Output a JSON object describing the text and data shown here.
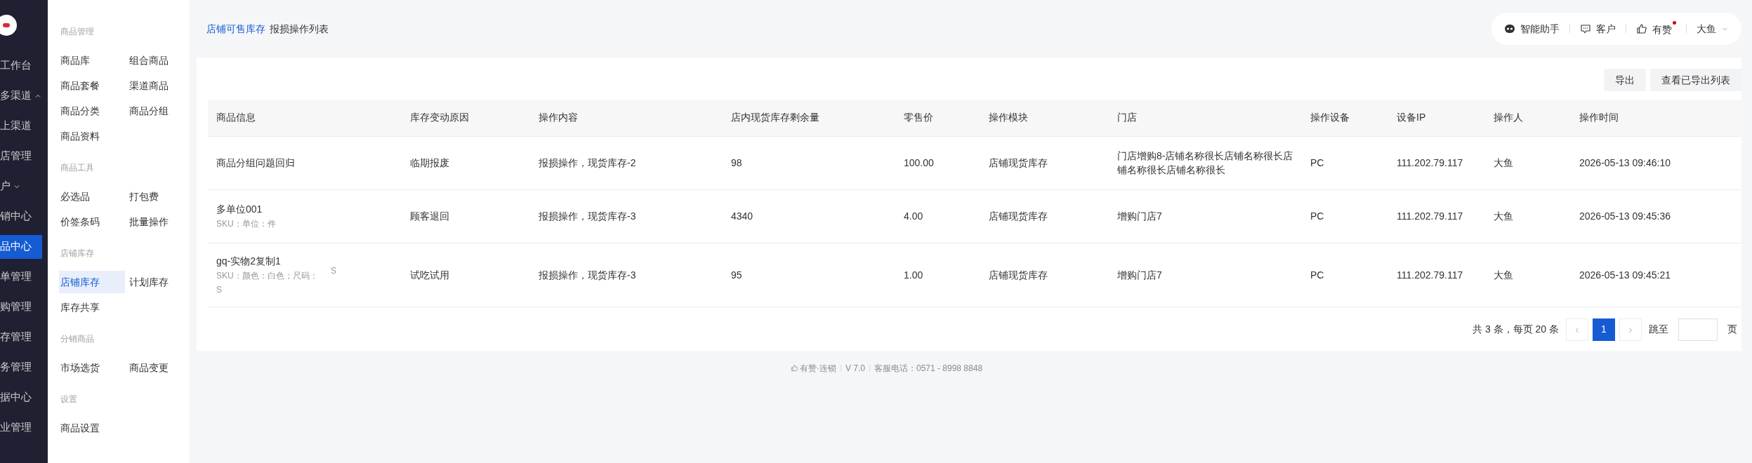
{
  "nav": [
    {
      "label": "工作台",
      "kind": "link",
      "selected": false
    },
    {
      "label": "多渠道",
      "kind": "group",
      "expanded": true,
      "selected": false,
      "children": [
        {
          "label": "上渠道",
          "selected": false
        },
        {
          "label": "店管理",
          "selected": false
        }
      ]
    },
    {
      "label": "户",
      "kind": "group",
      "expanded": false,
      "selected": false
    },
    {
      "label": "销中心",
      "kind": "link",
      "selected": false
    },
    {
      "label": "品中心",
      "kind": "link",
      "selected": true
    },
    {
      "label": "单管理",
      "kind": "link",
      "selected": false
    },
    {
      "label": "购管理",
      "kind": "link",
      "selected": false
    },
    {
      "label": "存管理",
      "kind": "link",
      "selected": false
    },
    {
      "label": "务管理",
      "kind": "link",
      "selected": false
    },
    {
      "label": "据中心",
      "kind": "link",
      "selected": false
    },
    {
      "label": "业管理",
      "kind": "link",
      "selected": false
    }
  ],
  "submenu": [
    {
      "title": "商品管理",
      "items": [
        {
          "label": "商品库",
          "selected": false
        },
        {
          "label": "组合商品",
          "selected": false
        },
        {
          "label": "商品套餐",
          "selected": false
        },
        {
          "label": "渠道商品",
          "selected": false
        },
        {
          "label": "商品分类",
          "selected": false
        },
        {
          "label": "商品分组",
          "selected": false
        },
        {
          "label": "商品资料",
          "selected": false
        }
      ]
    },
    {
      "title": "商品工具",
      "items": [
        {
          "label": "必选品",
          "selected": false
        },
        {
          "label": "打包费",
          "selected": false
        },
        {
          "label": "价签条码",
          "selected": false
        },
        {
          "label": "批量操作",
          "selected": false
        }
      ]
    },
    {
      "title": "店铺库存",
      "items": [
        {
          "label": "店铺库存",
          "selected": true
        },
        {
          "label": "计划库存",
          "selected": false
        },
        {
          "label": "库存共享",
          "selected": false
        }
      ]
    },
    {
      "title": "分销商品",
      "items": [
        {
          "label": "市场选货",
          "selected": false
        },
        {
          "label": "商品变更",
          "selected": false
        }
      ]
    },
    {
      "title": "设置",
      "items": [
        {
          "label": "商品设置",
          "selected": false
        }
      ]
    }
  ],
  "breadcrumb": [
    "店铺可售库存",
    "报损操作列表"
  ],
  "header_actions": [
    {
      "kind": "assistant",
      "label": "智能助手"
    },
    {
      "kind": "chat",
      "label": "客户"
    },
    {
      "kind": "like",
      "label": "有赞",
      "badge": true
    },
    {
      "kind": "user",
      "label": "大鱼"
    }
  ],
  "buttons": [
    "导出",
    "查看已导出列表"
  ],
  "table": {
    "columns": [
      "商品信息",
      "库存变动原因",
      "操作内容",
      "店内现货库存剩余量",
      "零售价",
      "操作模块",
      "门店",
      "操作设备",
      "设备IP",
      "操作人",
      "操作时间"
    ],
    "rows": [
      {
        "cells": [
          {
            "name": "商品分组问题回归"
          },
          "临期报废",
          "报损操作，现货库存-2",
          "98",
          "100.00",
          "店铺现货库存",
          "门店增购8-店铺名称很长店铺名称很长店铺名称很长店铺名称很长",
          "PC",
          "111.202.79.117",
          "大鱼",
          "2026-05-13 09:46:10"
        ]
      },
      {
        "cells": [
          {
            "name": "多单位001",
            "sku": "SKU：单位：件"
          },
          "顾客退回",
          "报损操作，现货库存-3",
          "4340",
          "4.00",
          "店铺现货库存",
          "增购门店7",
          "PC",
          "111.202.79.117",
          "大鱼",
          "2026-05-13 09:45:36"
        ]
      },
      {
        "cells": [
          {
            "name": "gq-实物2复制1",
            "sku": "SKU：颜色：白色；尺码：S",
            "sku_overflow": "S"
          },
          "试吃试用",
          "报损操作，现货库存-3",
          "95",
          "1.00",
          "店铺现货库存",
          "增购门店7",
          "PC",
          "111.202.79.117",
          "大鱼",
          "2026-05-13 09:45:21"
        ]
      }
    ]
  },
  "pagination": {
    "summary": "共 3 条，每页 20 条",
    "prev": "‹",
    "next": "›",
    "pages": [
      {
        "label": "1",
        "selected": true
      }
    ],
    "jump_label": "跳至",
    "page_unit": "页"
  },
  "footer": {
    "brand": "有赞·连锁",
    "version": "V 7.0",
    "phone": "客服电话：0571 - 8998 8848"
  }
}
